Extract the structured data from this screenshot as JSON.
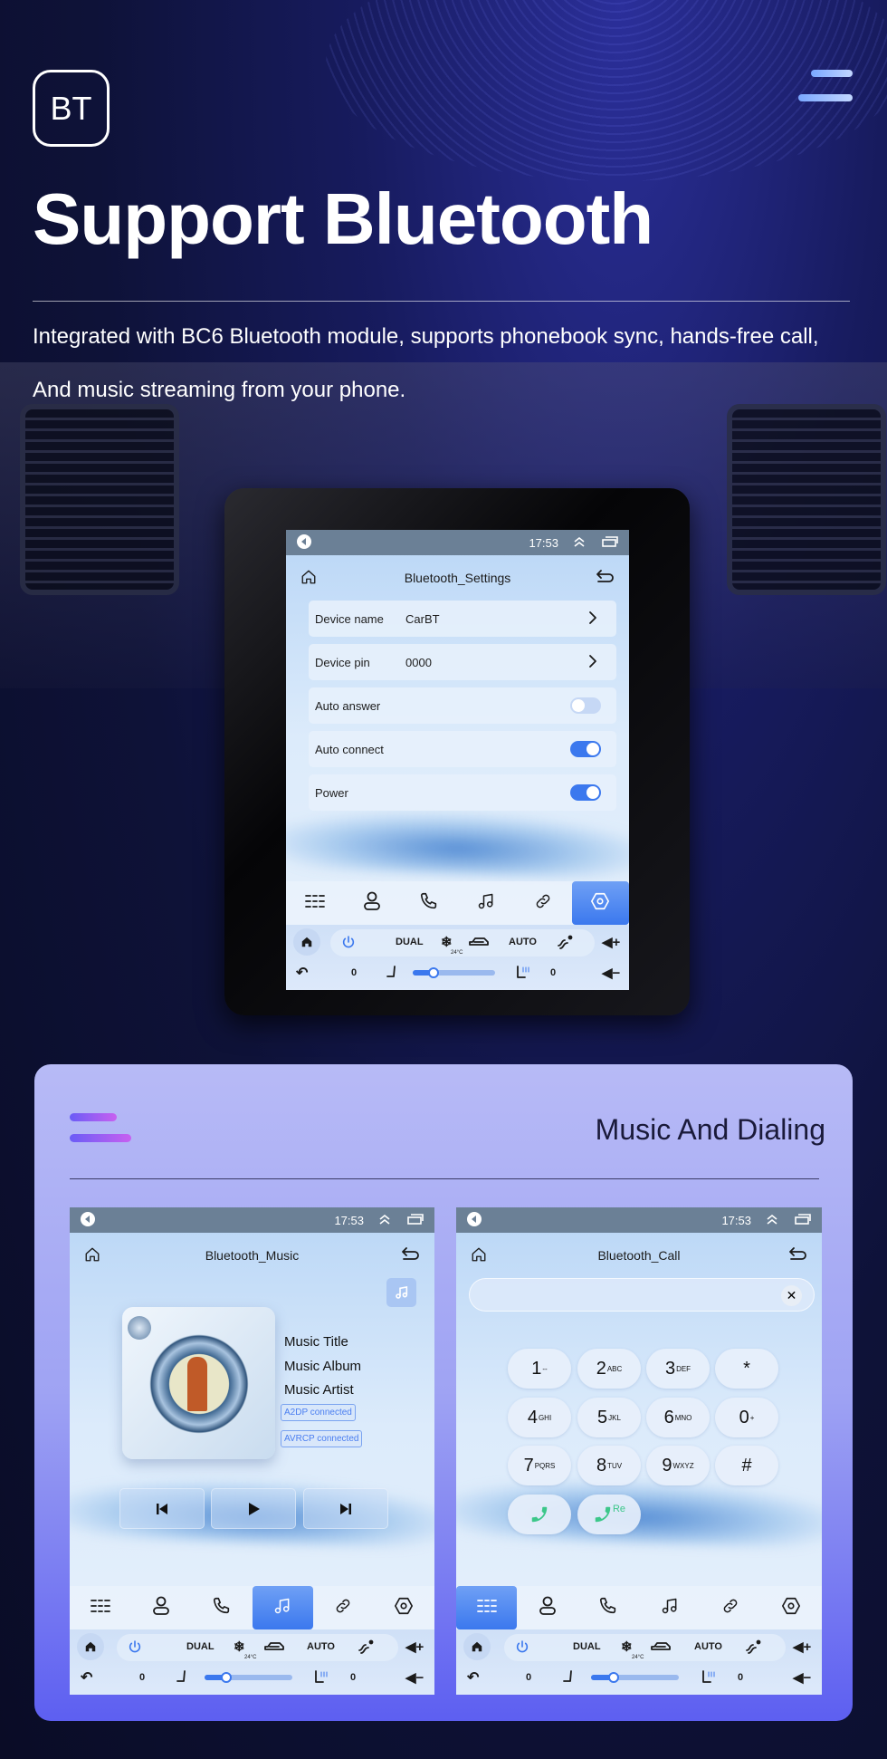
{
  "header": {
    "badge": "BT",
    "title": "Support Bluetooth",
    "description": [
      "Integrated with BC6 Bluetooth module, supports phonebook sync, hands-free call,",
      "And music streaming from your phone."
    ]
  },
  "section": {
    "title": "Music And Dialing"
  },
  "colors": {
    "accent": "#3b78ee",
    "status_bar": "#6b8096",
    "call_green": "#3cc78a",
    "card_top": "#b7baf6",
    "card_bottom": "#5d5ff1"
  },
  "common": {
    "time": "17:53",
    "nav_icons": [
      "apps-icon",
      "contacts-icon",
      "phone-icon",
      "music-icon",
      "link-icon",
      "settings-icon"
    ],
    "climate": {
      "dual": "DUAL",
      "auto": "AUTO",
      "temp": "24°C",
      "left_value": "0",
      "right_value": "0",
      "fan_level_percent": 25
    }
  },
  "settings_screen": {
    "title": "Bluetooth_Settings",
    "active_nav": 5,
    "rows": [
      {
        "label": "Device name",
        "value": "CarBT"
      },
      {
        "label": "Device pin",
        "value": "0000"
      },
      {
        "label": "Auto answer",
        "toggle": false
      },
      {
        "label": "Auto connect",
        "toggle": true
      },
      {
        "label": "Power",
        "toggle": true
      }
    ]
  },
  "music_screen": {
    "title": "Bluetooth_Music",
    "active_nav": 3,
    "track_title": "Music Title",
    "album": "Music Album",
    "artist": "Music Artist",
    "badges": [
      "A2DP connected",
      "AVRCP connected"
    ]
  },
  "call_screen": {
    "title": "Bluetooth_Call",
    "active_nav": 0,
    "input_value": "",
    "redial_label": "Re",
    "keys": [
      {
        "d": "1",
        "l": "--"
      },
      {
        "d": "2",
        "l": "ABC"
      },
      {
        "d": "3",
        "l": "DEF"
      },
      {
        "d": "*",
        "l": ""
      },
      {
        "d": "4",
        "l": "GHI"
      },
      {
        "d": "5",
        "l": "JKL"
      },
      {
        "d": "6",
        "l": "MNO"
      },
      {
        "d": "0",
        "l": "+"
      },
      {
        "d": "7",
        "l": "PQRS"
      },
      {
        "d": "8",
        "l": "TUV"
      },
      {
        "d": "9",
        "l": "WXYZ"
      },
      {
        "d": "#",
        "l": ""
      }
    ]
  }
}
